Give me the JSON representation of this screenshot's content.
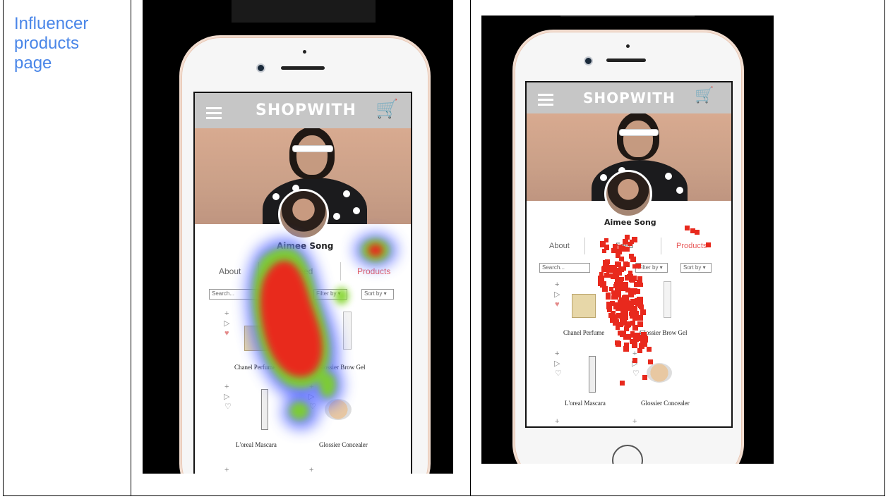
{
  "row_label": "Influencer\nproducts\npage",
  "app": {
    "logo": "SHOPWITH",
    "profile_name": "Aimee Song",
    "tabs": {
      "about": "About",
      "feed": "Feed",
      "products": "Products"
    },
    "search_placeholder": "Search...",
    "filter_label": "Filter by ▾",
    "sort_label": "Sort by ▾",
    "products": [
      {
        "name": "Chanel Perfume"
      },
      {
        "name": "Glossier Brow Gel"
      },
      {
        "name": "L'oreal Mascara"
      },
      {
        "name": "Glossier Concealer"
      }
    ]
  },
  "icons": {
    "menu": "hamburger-menu-icon",
    "cart": "cart-icon",
    "add": "plus-icon",
    "play": "play-icon",
    "like": "heart-icon"
  },
  "colors": {
    "label": "#4a86e8",
    "heat_hot": "#e8291d",
    "heat_warm": "#7ed321",
    "heat_cool": "#5a6cff",
    "active_tab": "#e85a5a"
  }
}
